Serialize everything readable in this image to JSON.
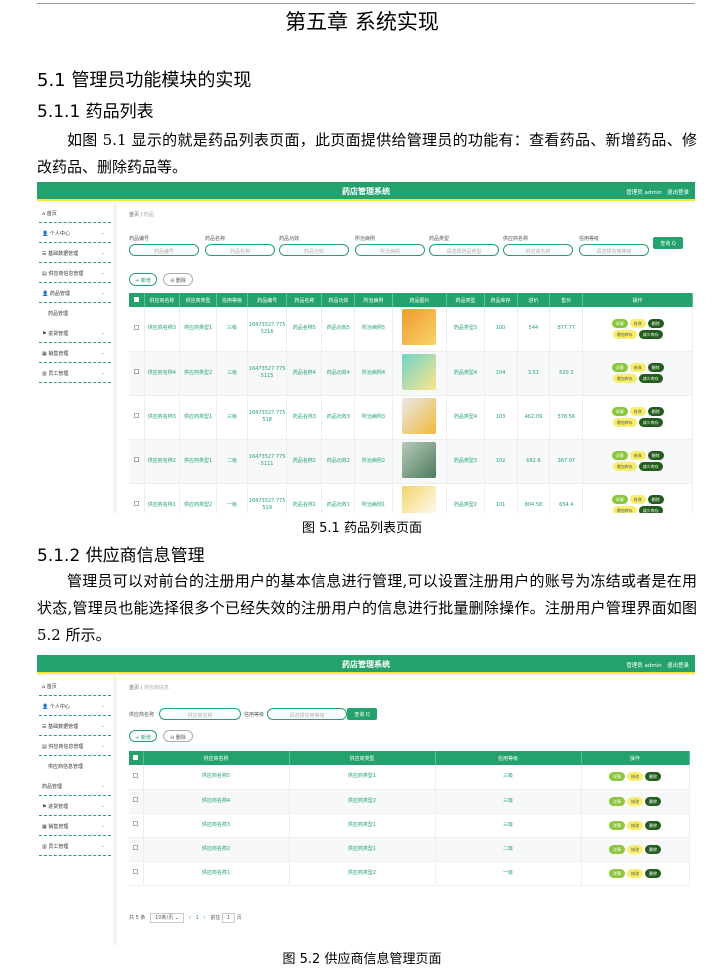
{
  "chapter_title": "第五章  系统实现",
  "section": "5.1  管理员功能模块的实现",
  "subsection1": "5.1.1  药品列表",
  "para1": "如图 5.1 显示的就是药品列表页面，此页面提供给管理员的功能有：查看药品、新增药品、修改药品、删除药品等。",
  "caption1": "图 5.1 药品列表页面",
  "subsection2": "5.1.2  供应商信息管理",
  "para2": "管理员可以对前台的注册用户的基本信息进行管理,可以设置注册用户的账号为冻结或者是在用状态,管理员也能选择很多个已经失效的注册用户的信息进行批量删除操作。注册用户管理界面如图 5.2 所示。",
  "caption2": "图 5.2  供应商信息管理页面",
  "app": {
    "title": "药店管理系统",
    "user": "管理员 admin",
    "logout": "退出登录",
    "home_crumb": "首页",
    "search_btn": "查询 Q",
    "add_btn": "+ 新增",
    "delete_btn": "删除"
  },
  "shot1": {
    "crumb_current": "药品",
    "sidebar": [
      "首页",
      "个人中心",
      "基础数据管理",
      "供应商信息管理",
      "药品管理",
      "药品管理",
      "进货管理",
      "销售管理",
      "员工管理"
    ],
    "filters": [
      {
        "label": "药品编号",
        "placeholder": "药品编号"
      },
      {
        "label": "药品名称",
        "placeholder": "药品名称"
      },
      {
        "label": "药品功效",
        "placeholder": "药品功效"
      },
      {
        "label": "所治病例",
        "placeholder": "所治病例"
      },
      {
        "label": "药品类型",
        "placeholder": "请选择药品类型"
      },
      {
        "label": "供应商名称",
        "placeholder": "供应商名称"
      },
      {
        "label": "信用等级",
        "placeholder": "请选择信用等级"
      }
    ],
    "headers": [
      "供应商名称",
      "供应商类型",
      "信用等级",
      "药品编号",
      "药品名称",
      "药品功效",
      "所治病例",
      "药品图片",
      "药品类型",
      "药品库存",
      "进价",
      "售价",
      "操作"
    ],
    "rows": [
      [
        "供应商名称3",
        "供应商类型1",
        "三级",
        "16473527 7755216",
        "药品名称5",
        "药品功效5",
        "所治病例5",
        "",
        "药品类型3",
        "100",
        "544",
        "877.77"
      ],
      [
        "供应商名称4",
        "供应商类型2",
        "三级",
        "16473527 7755115",
        "药品名称4",
        "药品功效4",
        "所治病例4",
        "",
        "药品类型4",
        "104",
        "3.51",
        "520.3"
      ],
      [
        "供应商名称3",
        "供应商类型1",
        "三级",
        "16473527 775518",
        "药品名称3",
        "药品功效3",
        "所治病例3",
        "",
        "药品类型4",
        "103",
        "462.09",
        "578.56"
      ],
      [
        "供应商名称2",
        "供应商类型1",
        "二级",
        "16473527 7755111",
        "药品名称2",
        "药品功效2",
        "所治病例2",
        "",
        "药品类型3",
        "102",
        "682.6",
        "367.07"
      ],
      [
        "供应商名称1",
        "供应商类型2",
        "一级",
        "16473527 775519",
        "药品名称1",
        "药品功效1",
        "所治病例1",
        "",
        "药品类型2",
        "101",
        "804.58",
        "654.4"
      ]
    ],
    "actions": [
      "详情",
      "修改",
      "删除",
      "增加库存",
      "减少库存"
    ]
  },
  "shot2": {
    "crumb_current": "供应商信息",
    "sidebar": [
      "首页",
      "个人中心",
      "基础数据管理",
      "供应商信息管理",
      "供应商信息管理",
      "药品管理",
      "进货管理",
      "销售管理",
      "员工管理"
    ],
    "filters": [
      {
        "label": "供应商名称",
        "placeholder": "供应商名称"
      },
      {
        "label": "信用等级",
        "placeholder": "请选择信用等级"
      }
    ],
    "headers": [
      "供应商名称",
      "供应商类型",
      "信用等级",
      "操作"
    ],
    "rows": [
      [
        "供应商名称5",
        "供应商类型1",
        "三级"
      ],
      [
        "供应商名称4",
        "供应商类型2",
        "三级"
      ],
      [
        "供应商名称3",
        "供应商类型1",
        "三级"
      ],
      [
        "供应商名称2",
        "供应商类型1",
        "二级"
      ],
      [
        "供应商名称1",
        "供应商类型2",
        "一级"
      ]
    ],
    "actions": [
      "详情",
      "修改",
      "删除"
    ],
    "pagination": {
      "total": "共 5 条",
      "page_size": "10条/页",
      "current": "1",
      "goto": "前往",
      "page_input": "1",
      "page_suffix": "页"
    }
  }
}
